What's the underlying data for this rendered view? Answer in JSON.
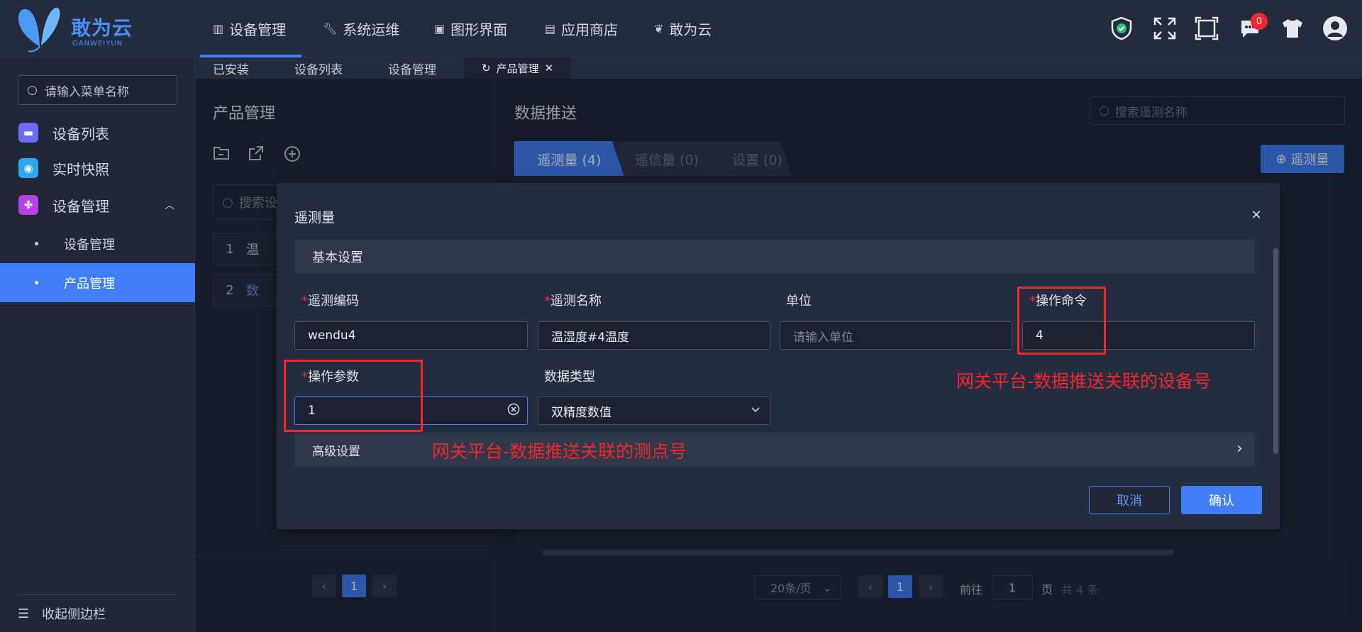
{
  "brand": {
    "name": "敢为云",
    "sub": "GANWEIYUN",
    "accent": "#3f7ef7",
    "annotation_color": "#f0282d"
  },
  "topnav": [
    {
      "label": "设备管理",
      "icon": "library-icon"
    },
    {
      "label": "系统运维",
      "icon": "wrench-icon"
    },
    {
      "label": "图形界面",
      "icon": "monitor-icon"
    },
    {
      "label": "应用商店",
      "icon": "store-icon"
    },
    {
      "label": "敢为云",
      "icon": "butterfly-icon"
    }
  ],
  "header_icons": [
    "shield-check-icon",
    "expand-icon",
    "fullscreen-icon",
    "chat-icon",
    "shirt-icon",
    "avatar-icon"
  ],
  "notification_count": "0",
  "sidebar": {
    "search_placeholder": "请输入菜单名称",
    "items": [
      {
        "label": "设备列表",
        "icon": "monitor-icon"
      },
      {
        "label": "实时快照",
        "icon": "camera-icon"
      },
      {
        "label": "设备管理",
        "icon": "clover-icon"
      }
    ],
    "subitems": [
      "设备管理",
      "产品管理"
    ],
    "collapse_label": "收起侧边栏"
  },
  "page_tabs": [
    "已安装",
    "设备列表",
    "设备管理",
    "产品管理"
  ],
  "left_panel": {
    "title": "产品管理",
    "search_placeholder": "搜索设",
    "rows": [
      {
        "index": "1",
        "name": "温"
      },
      {
        "index": "2",
        "name": "数"
      }
    ],
    "current_page": "1"
  },
  "right_panel": {
    "title": "数据推送",
    "search_placeholder": "搜索遥测名称",
    "tabs": [
      "遥测量 (4)",
      "遥信量 (0)",
      "设置 (0)"
    ],
    "add_button": "遥测量",
    "pagination": {
      "page_size": "20条/页",
      "current_page": "1",
      "goto_label": "前往",
      "goto_value": "1",
      "page_unit": "页",
      "total": "共 4 条"
    }
  },
  "modal": {
    "title": "遥测量",
    "close": "×",
    "basic_section": "基本设置",
    "advanced_section": "高级设置",
    "fields": {
      "code": {
        "label": "遥测编码",
        "value": "wendu4"
      },
      "name": {
        "label": "遥测名称",
        "value": "温湿度#4温度"
      },
      "unit": {
        "label": "单位",
        "placeholder": "请输入单位"
      },
      "command": {
        "label": "操作命令",
        "value": "4"
      },
      "param": {
        "label": "操作参数",
        "value": "1"
      },
      "datatype": {
        "label": "数据类型",
        "value": "双精度数值"
      }
    },
    "cancel": "取消",
    "confirm": "确认"
  },
  "annotations": {
    "device_note": "网关平台-数据推送关联的设备号",
    "point_note": "网关平台-数据推送关联的测点号"
  }
}
